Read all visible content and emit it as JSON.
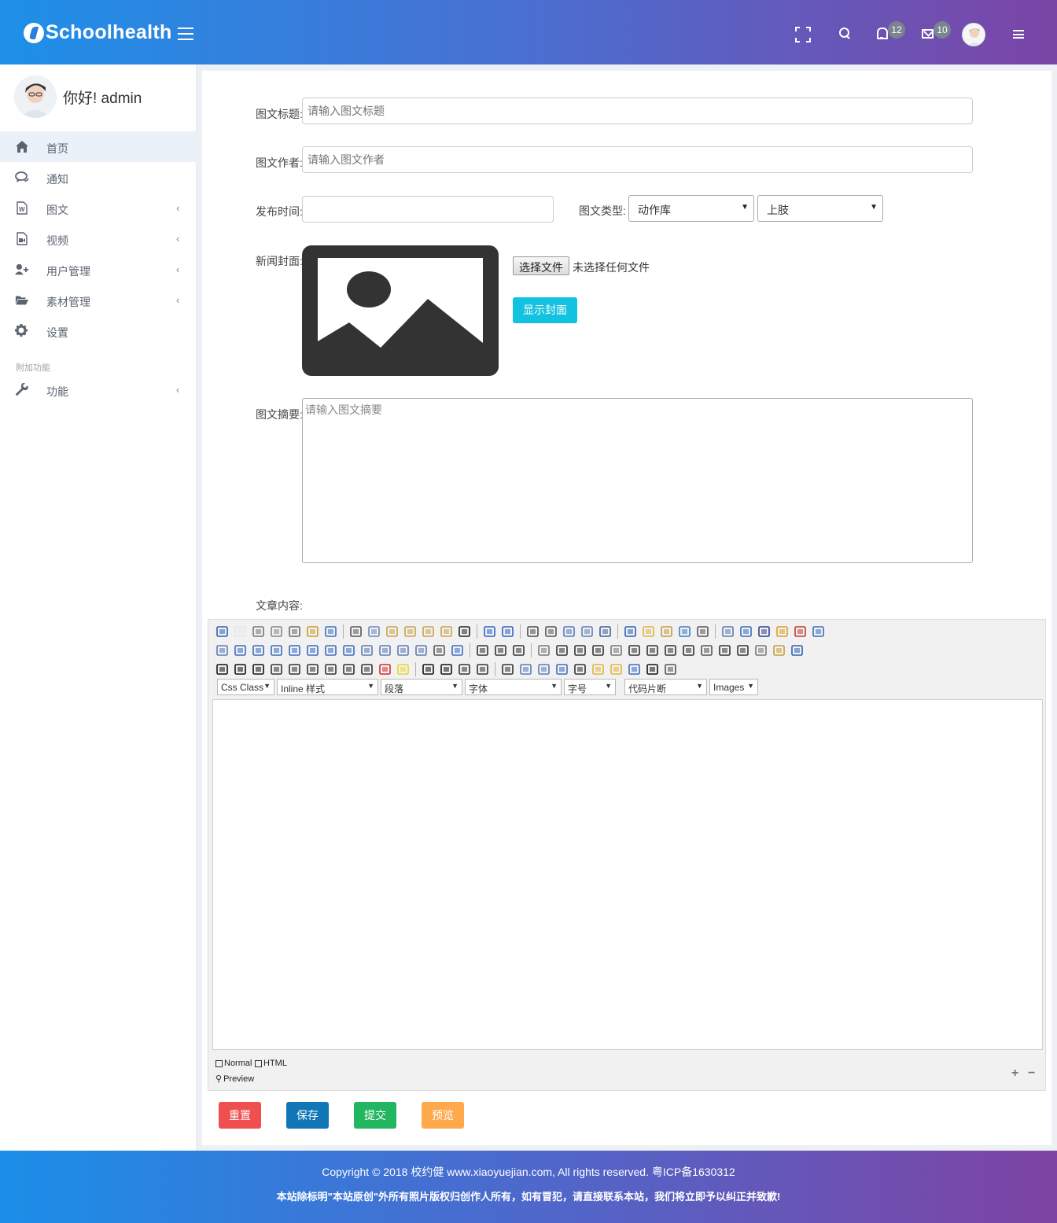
{
  "header": {
    "logo": "Schoolhealth",
    "notify_count": "12",
    "mail_count": "10"
  },
  "sidebar": {
    "greeting": "你好!  admin",
    "items": [
      {
        "label": "首页",
        "icon": "home-icon",
        "active": true,
        "has_children": false
      },
      {
        "label": "通知",
        "icon": "comments-icon",
        "active": false,
        "has_children": false
      },
      {
        "label": "图文",
        "icon": "word-file-icon",
        "active": false,
        "has_children": true
      },
      {
        "label": "视频",
        "icon": "video-file-icon",
        "active": false,
        "has_children": true
      },
      {
        "label": "用户管理",
        "icon": "user-plus-icon",
        "active": false,
        "has_children": true
      },
      {
        "label": "素材管理",
        "icon": "folder-open-icon",
        "active": false,
        "has_children": true
      },
      {
        "label": "设置",
        "icon": "gear-icon",
        "active": false,
        "has_children": false
      }
    ],
    "extra_caption": "附加功能",
    "extra_item": {
      "label": "功能",
      "icon": "wrench-icon",
      "has_children": true
    },
    "chevron": "‹"
  },
  "form": {
    "title_label": "图文标题:",
    "title_placeholder": "请输入图文标题",
    "author_label": "图文作者:",
    "author_placeholder": "请输入图文作者",
    "publish_label": "发布时间:",
    "publish_value": "",
    "type_label": "图文类型:",
    "type_select": "动作库",
    "type_sub_select": "上肢",
    "cover_label": "新闻封面:",
    "file_button": "选择文件",
    "file_note": "未选择任何文件",
    "show_cover_button": "显示封面",
    "summary_label": "图文摘要:",
    "summary_placeholder": "请输入图文摘要",
    "content_label": "文章内容:"
  },
  "editor": {
    "dropdowns": [
      "Css Class",
      "Inline 样式",
      "段落",
      "字体",
      "字号",
      "代码片断",
      "Images"
    ],
    "modes": [
      "Normal",
      "HTML",
      "Preview"
    ],
    "resize_plus": "+",
    "resize_minus": "−"
  },
  "actions": {
    "reset": "重置",
    "save": "保存",
    "submit": "提交",
    "preview": "预览",
    "colors": {
      "reset": "#ef4f4f",
      "save": "#1076b5",
      "submit": "#22b660",
      "preview": "#ffa94d"
    }
  },
  "footer": {
    "copyright": "Copyright © 2018 校约健 www.xiaoyuejian.com, All rights reserved. 粤ICP备1630312",
    "notice": "本站除标明\"本站原创\"外所有照片版权归创作人所有，如有冒犯，请直接联系本站，我们将立即予以纠正并致歉!"
  }
}
